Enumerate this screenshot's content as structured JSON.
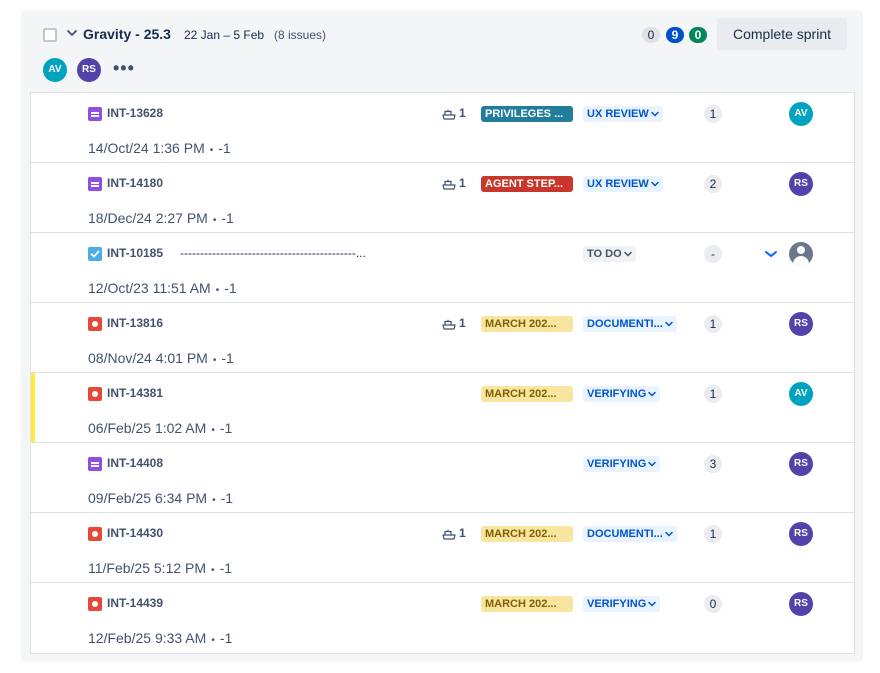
{
  "sprint": {
    "name": "Gravity - 25.3",
    "dates": "22 Jan – 5 Feb",
    "issue_count": "(8 issues)",
    "counts": {
      "todo": "0",
      "in_progress": "9",
      "done": "0"
    },
    "complete_label": "Complete sprint",
    "assignees": [
      "AV",
      "RS"
    ],
    "more_icon": "more-dots-icon"
  },
  "colors": {
    "story": "#904ee2",
    "task": "#4bade8",
    "bug": "#e5493a",
    "flag": "#ffeb3b",
    "av_teal": "#00a3bf",
    "av_purple": "#5243aa"
  },
  "issues": [
    {
      "type": "story",
      "key": "INT-13628",
      "summary": "",
      "subtasks": "1",
      "epic": "PRIVILEGES ...",
      "epic_bg": "#227d9b",
      "epic_fg": "#ffffff",
      "status": "UX REVIEW",
      "points": "1",
      "assignee": "AV",
      "meta_date": "14/Oct/24 1:36 PM",
      "meta_value": "-1"
    },
    {
      "type": "story",
      "key": "INT-14180",
      "summary": "",
      "subtasks": "1",
      "epic": "AGENT STEP...",
      "epic_bg": "#c9372c",
      "epic_fg": "#ffffff",
      "status": "UX REVIEW",
      "points": "2",
      "assignee": "RS",
      "meta_date": "18/Dec/24 2:27 PM",
      "meta_value": "-1"
    },
    {
      "type": "task",
      "key": "INT-10185",
      "summary": "--------------------------------------------...",
      "subtasks": "",
      "epic": "",
      "status": "TO DO",
      "points": "-",
      "assignee": "",
      "meta_date": "12/Oct/23 11:51 AM",
      "meta_value": "-1"
    },
    {
      "type": "bug",
      "key": "INT-13816",
      "summary": "",
      "subtasks": "1",
      "epic": "MARCH 202...",
      "epic_bg": "#f8e6a0",
      "epic_fg": "#7f5f01",
      "status": "DOCUMENTI...",
      "points": "1",
      "assignee": "RS",
      "meta_date": "08/Nov/24 4:01 PM",
      "meta_value": "-1"
    },
    {
      "type": "bug",
      "key": "INT-14381",
      "summary": "",
      "subtasks": "",
      "epic": "MARCH 202...",
      "epic_bg": "#f8e6a0",
      "epic_fg": "#7f5f01",
      "status": "VERIFYING",
      "points": "1",
      "assignee": "AV",
      "flagged": true,
      "meta_date": "06/Feb/25 1:02 AM",
      "meta_value": "-1"
    },
    {
      "type": "story",
      "key": "INT-14408",
      "summary": "",
      "subtasks": "",
      "epic": "",
      "status": "VERIFYING",
      "points": "3",
      "assignee": "RS",
      "meta_date": "09/Feb/25 6:34 PM",
      "meta_value": "-1"
    },
    {
      "type": "bug",
      "key": "INT-14430",
      "summary": "",
      "subtasks": "1",
      "epic": "MARCH 202...",
      "epic_bg": "#f8e6a0",
      "epic_fg": "#7f5f01",
      "status": "DOCUMENTI...",
      "points": "1",
      "assignee": "RS",
      "meta_date": "11/Feb/25 5:12 PM",
      "meta_value": "-1"
    },
    {
      "type": "bug",
      "key": "INT-14439",
      "summary": "",
      "subtasks": "",
      "epic": "MARCH 202...",
      "epic_bg": "#f8e6a0",
      "epic_fg": "#7f5f01",
      "status": "VERIFYING",
      "points": "0",
      "assignee": "RS",
      "meta_date": "12/Feb/25 9:33 AM",
      "meta_value": "-1"
    }
  ]
}
